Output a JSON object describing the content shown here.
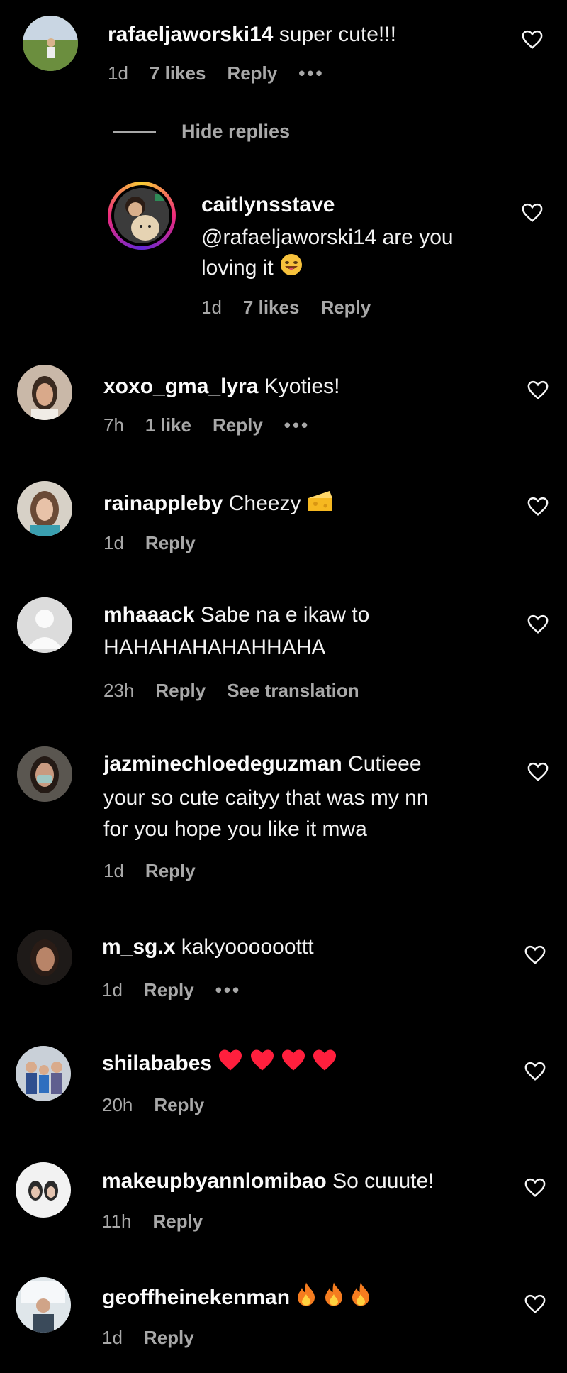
{
  "comments": [
    {
      "username": "rafaeljaworski14",
      "text": "super cute!!!",
      "time": "1d",
      "likes": "7 likes",
      "reply": "Reply",
      "more": "•••"
    },
    {
      "hide_replies": "Hide replies"
    },
    {
      "username": "caitlynsstave",
      "text": "@rafaeljaworski14 are you",
      "text2": "loving it",
      "time": "1d",
      "likes": "7 likes",
      "reply": "Reply"
    },
    {
      "username": "xoxo_gma_lyra",
      "text": "Kyoties!",
      "time": "7h",
      "likes": "1 like",
      "reply": "Reply",
      "more": "•••"
    },
    {
      "username": "rainappleby",
      "text": "Cheezy",
      "time": "1d",
      "reply": "Reply"
    },
    {
      "username": "mhaaack",
      "text": "Sabe na e ikaw to",
      "text2": "HAHAHAHAHAHHAHA",
      "time": "23h",
      "reply": "Reply",
      "see_translation": "See translation"
    },
    {
      "username": "jazminechloedeguzman",
      "text": "Cutieee",
      "text2": "your so cute caityy that was my nn",
      "text3": "for you hope you like it mwa",
      "time": "1d",
      "reply": "Reply"
    },
    {
      "username": "m_sg.x",
      "text": "kakyoooooottt",
      "time": "1d",
      "reply": "Reply",
      "more": "•••"
    },
    {
      "username": "shilababes",
      "text": "",
      "time": "20h",
      "reply": "Reply"
    },
    {
      "username": "makeupbyannlomibao",
      "text": "So cuuute!",
      "time": "11h",
      "reply": "Reply"
    },
    {
      "username": "geoffheinekenman",
      "text": "",
      "time": "1d",
      "reply": "Reply"
    }
  ],
  "icons": {
    "like": "heart-outline-icon",
    "more": "more-dots-icon"
  },
  "colors": {
    "background": "#000000",
    "text": "#f5f5f5",
    "meta": "#a8a8a8",
    "heart_emoji": "#ff1f3d"
  }
}
